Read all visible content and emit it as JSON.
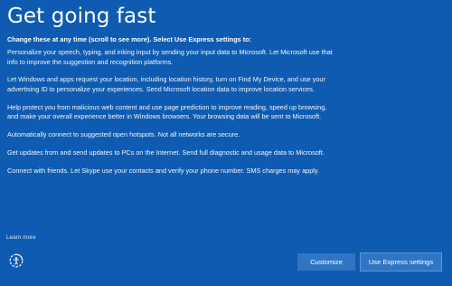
{
  "page": {
    "title": "Get going fast"
  },
  "content": {
    "lead": "Change these at any time (scroll to see more). Select Use Express settings to:",
    "paragraphs": [
      "Personalize your speech, typing, and inking input by sending your input data to Microsoft. Let Microsoft use that info to improve the suggestion and recognition platforms.",
      "Let Windows and apps request your location, including location history, turn on Find My Device, and use your advertising ID to personalize your experiences. Send Microsoft location data to improve location services.",
      "Help protect you from malicious web content and use page prediction to improve reading, speed up browsing, and make your overall experience better in Windows browsers. Your browsing data will be sent to Microsoft.",
      "Automatically connect to suggested open hotspots. Not all networks are secure.",
      "Get updates from and send updates to PCs on the Internet. Send full diagnostic and usage data to Microsoft.",
      "Connect with friends. Let Skype use your contacts and verify your phone number. SMS charges may apply."
    ]
  },
  "footer": {
    "learn_more": "Learn more",
    "accessibility_icon": "ease-of-access-icon",
    "customize_label": "Customize",
    "express_label": "Use Express settings"
  },
  "colors": {
    "background": "#0f5bb1",
    "button": "#2f75c4",
    "text": "#ffffff"
  }
}
